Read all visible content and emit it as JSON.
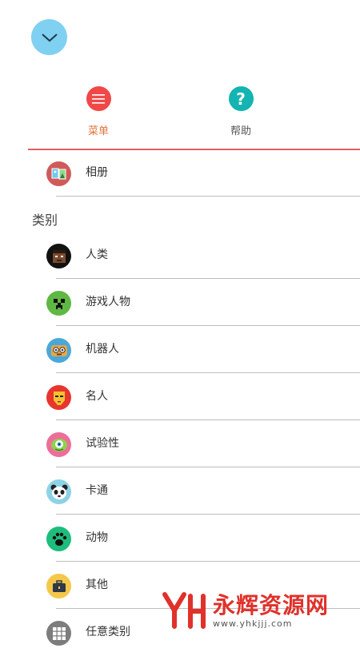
{
  "tabs": [
    {
      "label": "菜单",
      "icon": "menu-icon",
      "color": "#f04848",
      "active": true
    },
    {
      "label": "帮助",
      "icon": "help-icon",
      "color": "#13b4b1",
      "active": false
    }
  ],
  "album": {
    "label": "相册",
    "icon": "album-icon"
  },
  "category_section": {
    "title": "类别"
  },
  "categories": [
    {
      "label": "人类",
      "icon": "human-face-icon",
      "color": "#111111"
    },
    {
      "label": "游戏人物",
      "icon": "creeper-icon",
      "color": "#5fb843"
    },
    {
      "label": "机器人",
      "icon": "robot-icon",
      "color": "#4aa8d8"
    },
    {
      "label": "名人",
      "icon": "ironman-icon",
      "color": "#e8352d"
    },
    {
      "label": "试验性",
      "icon": "monster-icon",
      "color": "#ec6f9a"
    },
    {
      "label": "卡通",
      "icon": "panda-icon",
      "color": "#8ed2e6"
    },
    {
      "label": "动物",
      "icon": "paw-icon",
      "color": "#1dbd7c"
    },
    {
      "label": "其他",
      "icon": "briefcase-icon",
      "color": "#f5c84a"
    },
    {
      "label": "任意类别",
      "icon": "grid-icon",
      "color": "#7d7d7d"
    }
  ],
  "watermark": {
    "brand": "永辉资源网",
    "url": "www.yhkjjj.com"
  }
}
